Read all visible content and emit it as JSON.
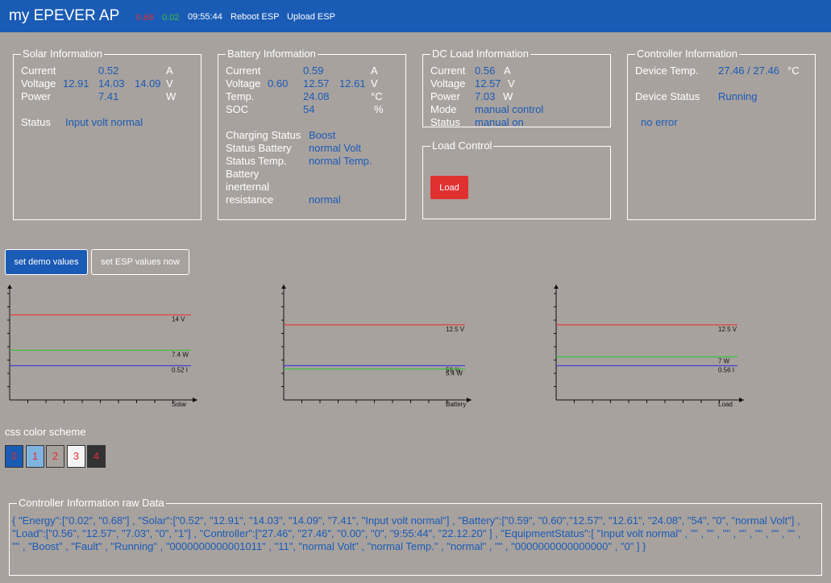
{
  "header": {
    "title": "my EPEVER AP",
    "energy_red": "0.68",
    "energy_green": "0.02",
    "time": "09:55:44",
    "reboot": "Reboot ESP",
    "upload": "Upload ESP"
  },
  "solar": {
    "legend": "Solar Information",
    "current_label": "Current",
    "current_val": "0.52",
    "current_unit": "A",
    "voltage_label": "Voltage",
    "voltage_v1": "12.91",
    "voltage_v2": "14.03",
    "voltage_v3": "14.09",
    "voltage_unit": "V",
    "power_label": "Power",
    "power_val": "7.41",
    "power_unit": "W",
    "status_label": "Status",
    "status_val": "Input volt normal"
  },
  "battery": {
    "legend": "Battery Information",
    "current_label": "Current",
    "current_val": "0.59",
    "current_unit": "A",
    "voltage_label": "Voltage",
    "voltage_v1": "0.60",
    "voltage_v2": "12.57",
    "voltage_v3": "12.61",
    "voltage_unit": "V",
    "temp_label": "Temp.",
    "temp_val": "24.08",
    "temp_unit": "°C",
    "soc_label": "SOC",
    "soc_val": "54",
    "soc_unit": "%",
    "charging_label": "Charging Status",
    "charging_val": "Boost",
    "status_batt_label": "Status Battery",
    "status_batt_val": "normal Volt",
    "status_temp_label": "Status Temp.",
    "status_temp_val": "normal Temp.",
    "resist_label_1": "Battery",
    "resist_label_2": "inerternal",
    "resist_label_3": "resistance",
    "resist_val": "normal"
  },
  "dcload": {
    "legend": "DC Load Information",
    "current_label": "Current",
    "current_val": "0.56",
    "current_unit": "A",
    "voltage_label": "Voltage",
    "voltage_val": "12.57",
    "voltage_unit": "V",
    "power_label": "Power",
    "power_val": "7.03",
    "power_unit": "W",
    "mode_label": "Mode",
    "mode_val": "manual control",
    "status_label": "Status",
    "status_val": "manual on"
  },
  "loadcontrol": {
    "legend": "Load Control",
    "button": "Load"
  },
  "controller": {
    "legend": "Controller Information",
    "temp_label": "Device Temp.",
    "temp_val": "27.46 / 27.46",
    "temp_unit": "°C",
    "status_label": "Device Status",
    "status_val": "Running",
    "error_val": "no error"
  },
  "buttons": {
    "demo": "set demo values",
    "esp": "set ESP values now"
  },
  "charts": [
    {
      "name": "Solar",
      "lines": [
        {
          "label": "14 V",
          "color": "#e04040",
          "level": 0.77
        },
        {
          "label": "7.4 W",
          "color": "#40c040",
          "level": 0.45
        },
        {
          "label": "0.52 I",
          "color": "#4040d0",
          "level": 0.31
        }
      ]
    },
    {
      "name": "Battery",
      "lines": [
        {
          "label": "12.5 V",
          "color": "#e04040",
          "level": 0.68
        },
        {
          "label": "59 %",
          "color": "#4040d0",
          "level": 0.31
        },
        {
          "label": "5.4 W",
          "color": "#40c040",
          "level": 0.28
        }
      ]
    },
    {
      "name": "Load",
      "lines": [
        {
          "label": "12.5 V",
          "color": "#e04040",
          "level": 0.68
        },
        {
          "label": "7 W",
          "color": "#40c040",
          "level": 0.39
        },
        {
          "label": "0.56 I",
          "color": "#4040d0",
          "level": 0.31
        }
      ]
    }
  ],
  "color_scheme": {
    "label": "css color scheme",
    "swatches": [
      {
        "num": "0",
        "bg": "#1a5bb5",
        "fg": "#e03030"
      },
      {
        "num": "1",
        "bg": "#7fb3e0",
        "fg": "#e03030"
      },
      {
        "num": "2",
        "bg": "#a8a29f",
        "fg": "#e03030"
      },
      {
        "num": "3",
        "bg": "#f5f5f5",
        "fg": "#e03030"
      },
      {
        "num": "4",
        "bg": "#333333",
        "fg": "#e03030"
      }
    ]
  },
  "raw": {
    "legend": "Controller Information raw Data",
    "text": "{ \"Energy\":[\"0.02\", \"0.68\"] , \"Solar\":[\"0.52\", \"12.91\", \"14.03\", \"14.09\", \"7.41\", \"Input volt normal\"] , \"Battery\":[\"0.59\", \"0.60\",\"12.57\", \"12.61\", \"24.08\", \"54\", \"0\", \"normal Volt\"] , \"Load\":[\"0.56\", \"12.57\", \"7.03\", \"0\", \"1\"] , \"Controller\":[\"27.46\", \"27.46\", \"0.00\", \"0\", \"9:55:44\", \"22.12.20\" ] , \"EquipmentStatus\":[ \"Input volt normal\" , \"\" , \"\" , \"\" , \"\" , \"\" , \"\" , \"\" , \"\" , \"Boost\" , \"Fault\" , \"Running\" , \"0000000000001011\" , \"11\", \"normal Volt\" , \"normal Temp.\" , \"normal\" , \"\" , \"0000000000000000\" , \"0\" ] }"
  }
}
